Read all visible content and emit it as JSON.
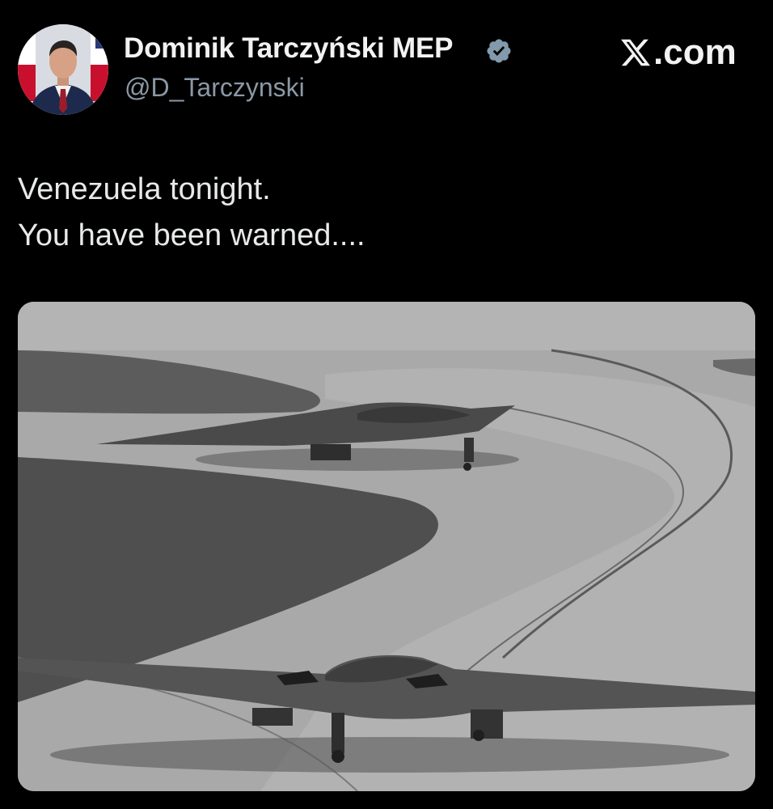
{
  "author": {
    "display_name": "Dominik Tarczyński MEP",
    "handle": "@D_Tarczynski",
    "verified": true,
    "avatar_icon": "profile-photo"
  },
  "brand": {
    "label": ".com",
    "icon": "x-logo-icon"
  },
  "tweet": {
    "lines": [
      "Venezuela tonight.",
      "You have been warned...."
    ]
  },
  "media": {
    "type": "photo",
    "color_mode": "grayscale",
    "subject": "two stealth bombers on a runway taxiway"
  },
  "colors": {
    "background": "#000000",
    "text": "#e7e9ea",
    "handle": "#8b98a5",
    "verified_badge": "#829aab"
  }
}
